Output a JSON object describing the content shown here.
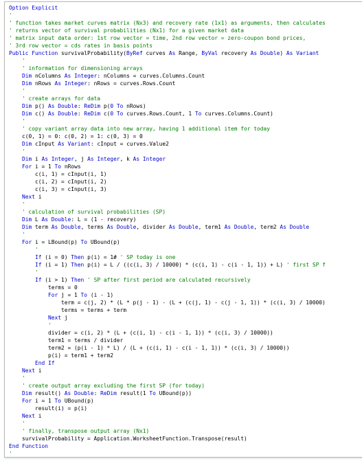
{
  "colors": {
    "keyword": "#0000d0",
    "comment": "#008000",
    "text": "#000000",
    "border": "#b9b9b9",
    "background": "#ffffff"
  },
  "code_lines": [
    [
      [
        "k",
        "Option Explicit"
      ]
    ],
    [
      [
        "c",
        "'"
      ]
    ],
    [
      [
        "c",
        "' function takes market curves matrix (Nx3) and recovery rate (1x1) as arguments, then calculates"
      ]
    ],
    [
      [
        "c",
        "' returns vector of survival probabilities (Nx1) for a given market data"
      ]
    ],
    [
      [
        "c",
        "' matrix input data order: 1st row vector = time, 2nd row vector = zero-coupon bond prices,"
      ]
    ],
    [
      [
        "c",
        "' 3rd row vector = cds rates in basis points"
      ]
    ],
    [
      [
        "k",
        "Public Function"
      ],
      [
        "t",
        " survivalProbability("
      ],
      [
        "k",
        "ByRef"
      ],
      [
        "t",
        " curves "
      ],
      [
        "k",
        "As"
      ],
      [
        "t",
        " Range, "
      ],
      [
        "k",
        "ByVal"
      ],
      [
        "t",
        " recovery "
      ],
      [
        "k",
        "As Double"
      ],
      [
        "t",
        ") "
      ],
      [
        "k",
        "As Variant"
      ]
    ],
    [
      [
        "t",
        "    "
      ],
      [
        "c",
        "'"
      ]
    ],
    [
      [
        "t",
        "    "
      ],
      [
        "c",
        "' information for dimensioning arrays"
      ]
    ],
    [
      [
        "t",
        "    "
      ],
      [
        "k",
        "Dim"
      ],
      [
        "t",
        " nColumns "
      ],
      [
        "k",
        "As Integer"
      ],
      [
        "t",
        ": nColumns = curves.Columns.Count"
      ]
    ],
    [
      [
        "t",
        "    "
      ],
      [
        "k",
        "Dim"
      ],
      [
        "t",
        " nRows "
      ],
      [
        "k",
        "As Integer"
      ],
      [
        "t",
        ": nRows = curves.Rows.Count"
      ]
    ],
    [
      [
        "t",
        "    "
      ],
      [
        "c",
        "'"
      ]
    ],
    [
      [
        "t",
        "    "
      ],
      [
        "c",
        "' create arrays for data"
      ]
    ],
    [
      [
        "t",
        "    "
      ],
      [
        "k",
        "Dim"
      ],
      [
        "t",
        " p() "
      ],
      [
        "k",
        "As Double"
      ],
      [
        "t",
        ": "
      ],
      [
        "k",
        "ReDim"
      ],
      [
        "t",
        " p("
      ],
      [
        "k",
        "0 To"
      ],
      [
        "t",
        " nRows)"
      ]
    ],
    [
      [
        "t",
        "    "
      ],
      [
        "k",
        "Dim"
      ],
      [
        "t",
        " c() "
      ],
      [
        "k",
        "As Double"
      ],
      [
        "t",
        ": "
      ],
      [
        "k",
        "ReDim"
      ],
      [
        "t",
        " c("
      ],
      [
        "k",
        "0 To"
      ],
      [
        "t",
        " curves.Rows.Count, 1 "
      ],
      [
        "k",
        "To"
      ],
      [
        "t",
        " curves.Columns.Count)"
      ]
    ],
    [
      [
        "t",
        "    "
      ],
      [
        "c",
        "'"
      ]
    ],
    [
      [
        "t",
        "    "
      ],
      [
        "c",
        "' copy variant array data into new array, having 1 additional item for today"
      ]
    ],
    [
      [
        "t",
        "    c(0, 1) = 0: c(0, 2) = 1: c(0, 3) = 0"
      ]
    ],
    [
      [
        "t",
        "    "
      ],
      [
        "k",
        "Dim"
      ],
      [
        "t",
        " cInput "
      ],
      [
        "k",
        "As Variant"
      ],
      [
        "t",
        ": cInput = curves.Value2"
      ]
    ],
    [
      [
        "t",
        "    "
      ],
      [
        "c",
        "'"
      ]
    ],
    [
      [
        "t",
        "    "
      ],
      [
        "k",
        "Dim"
      ],
      [
        "t",
        " i "
      ],
      [
        "k",
        "As Integer"
      ],
      [
        "t",
        ", j "
      ],
      [
        "k",
        "As Integer"
      ],
      [
        "t",
        ", k "
      ],
      [
        "k",
        "As Integer"
      ]
    ],
    [
      [
        "t",
        "    "
      ],
      [
        "k",
        "For"
      ],
      [
        "t",
        " i = 1 "
      ],
      [
        "k",
        "To"
      ],
      [
        "t",
        " nRows"
      ]
    ],
    [
      [
        "t",
        "        c(i, 1) = cInput(i, 1)"
      ]
    ],
    [
      [
        "t",
        "        c(i, 2) = cInput(i, 2)"
      ]
    ],
    [
      [
        "t",
        "        c(i, 3) = cInput(i, 3)"
      ]
    ],
    [
      [
        "t",
        "    "
      ],
      [
        "k",
        "Next"
      ],
      [
        "t",
        " i"
      ]
    ],
    [
      [
        "t",
        "    "
      ],
      [
        "c",
        "'"
      ]
    ],
    [
      [
        "t",
        "    "
      ],
      [
        "c",
        "' calculation of survival probabilities (SP)"
      ]
    ],
    [
      [
        "t",
        "    "
      ],
      [
        "k",
        "Dim"
      ],
      [
        "t",
        " L "
      ],
      [
        "k",
        "As Double"
      ],
      [
        "t",
        ": L = (1 - recovery)"
      ]
    ],
    [
      [
        "t",
        "    "
      ],
      [
        "k",
        "Dim"
      ],
      [
        "t",
        " term "
      ],
      [
        "k",
        "As Double"
      ],
      [
        "t",
        ", terms "
      ],
      [
        "k",
        "As Double"
      ],
      [
        "t",
        ", divider "
      ],
      [
        "k",
        "As Double"
      ],
      [
        "t",
        ", term1 "
      ],
      [
        "k",
        "As Double"
      ],
      [
        "t",
        ", term2 "
      ],
      [
        "k",
        "As Double"
      ]
    ],
    [
      [
        "t",
        "    "
      ],
      [
        "c",
        "'"
      ]
    ],
    [
      [
        "t",
        "    "
      ],
      [
        "k",
        "For"
      ],
      [
        "t",
        " i = LBound(p) "
      ],
      [
        "k",
        "To"
      ],
      [
        "t",
        " UBound(p)"
      ]
    ],
    [
      [
        "t",
        "        "
      ],
      [
        "c",
        "'"
      ]
    ],
    [
      [
        "t",
        "        "
      ],
      [
        "k",
        "If"
      ],
      [
        "t",
        " (i = 0) "
      ],
      [
        "k",
        "Then"
      ],
      [
        "t",
        " p(i) = 1# "
      ],
      [
        "c",
        "' SP today is one"
      ]
    ],
    [
      [
        "t",
        "        "
      ],
      [
        "k",
        "If"
      ],
      [
        "t",
        " (i = 1) "
      ],
      [
        "k",
        "Then"
      ],
      [
        "t",
        " p(i) = L / ((c(i, 3) / 10000) * (c(i, 1) - c(i - 1, 1)) + L) "
      ],
      [
        "c",
        "' first SP f"
      ]
    ],
    [
      [
        "t",
        "        "
      ],
      [
        "c",
        "'"
      ]
    ],
    [
      [
        "t",
        "        "
      ],
      [
        "k",
        "If"
      ],
      [
        "t",
        " (i > 1) "
      ],
      [
        "k",
        "Then"
      ],
      [
        "t",
        " "
      ],
      [
        "c",
        "' SP after first period are calculated recursively"
      ]
    ],
    [
      [
        "t",
        "            terms = 0"
      ]
    ],
    [
      [
        "t",
        "            "
      ],
      [
        "k",
        "For"
      ],
      [
        "t",
        " j = 1 "
      ],
      [
        "k",
        "To"
      ],
      [
        "t",
        " (i - 1)"
      ]
    ],
    [
      [
        "t",
        "                term = c(j, 2) * (L * p(j - 1) - (L + (c(j, 1) - c(j - 1, 1)) * (c(i, 3) / 10000)"
      ]
    ],
    [
      [
        "t",
        "                terms = terms + term"
      ]
    ],
    [
      [
        "t",
        "            "
      ],
      [
        "k",
        "Next"
      ],
      [
        "t",
        " j"
      ]
    ],
    [
      [
        "t",
        "            "
      ],
      [
        "c",
        "'"
      ]
    ],
    [
      [
        "t",
        "            divider = c(i, 2) * (L + (c(i, 1) - c(i - 1, 1)) * (c(i, 3) / 10000))"
      ]
    ],
    [
      [
        "t",
        "            term1 = terms / divider"
      ]
    ],
    [
      [
        "t",
        "            term2 = (p(i - 1) * L) / (L + (c(i, 1) - c(i - 1, 1)) * (c(i, 3) / 10000))"
      ]
    ],
    [
      [
        "t",
        "            p(i) = term1 + term2"
      ]
    ],
    [
      [
        "t",
        "        "
      ],
      [
        "k",
        "End If"
      ]
    ],
    [
      [
        "t",
        "    "
      ],
      [
        "k",
        "Next"
      ],
      [
        "t",
        " i"
      ]
    ],
    [
      [
        "t",
        "    "
      ],
      [
        "c",
        "'"
      ]
    ],
    [
      [
        "t",
        "    "
      ],
      [
        "c",
        "' create output array excluding the first SP (for today)"
      ]
    ],
    [
      [
        "t",
        "    "
      ],
      [
        "k",
        "Dim"
      ],
      [
        "t",
        " result() "
      ],
      [
        "k",
        "As Double"
      ],
      [
        "t",
        ": "
      ],
      [
        "k",
        "ReDim"
      ],
      [
        "t",
        " result(1 "
      ],
      [
        "k",
        "To"
      ],
      [
        "t",
        " UBound(p))"
      ]
    ],
    [
      [
        "t",
        "    "
      ],
      [
        "k",
        "For"
      ],
      [
        "t",
        " i = 1 "
      ],
      [
        "k",
        "To"
      ],
      [
        "t",
        " UBound(p)"
      ]
    ],
    [
      [
        "t",
        "        result(i) = p(i)"
      ]
    ],
    [
      [
        "t",
        "    "
      ],
      [
        "k",
        "Next"
      ],
      [
        "t",
        " i"
      ]
    ],
    [
      [
        "t",
        "    "
      ],
      [
        "c",
        "'"
      ]
    ],
    [
      [
        "t",
        "    "
      ],
      [
        "c",
        "' finally, transpose output array (Nx1)"
      ]
    ],
    [
      [
        "t",
        "    survivalProbability = Application.WorksheetFunction.Transpose(result)"
      ]
    ],
    [
      [
        "k",
        "End Function"
      ]
    ],
    [
      [
        "c",
        "'"
      ]
    ]
  ]
}
